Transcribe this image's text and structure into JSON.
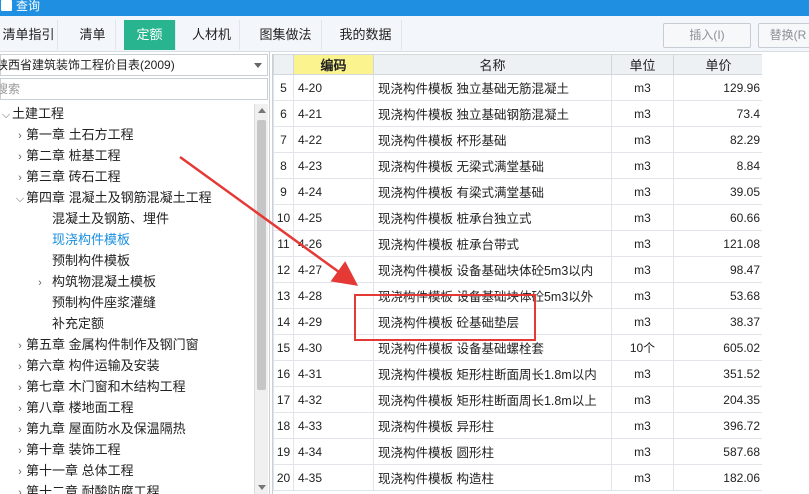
{
  "window": {
    "title": "查询"
  },
  "tabs": [
    {
      "label": "清单指引",
      "active": false
    },
    {
      "label": "清单",
      "active": false
    },
    {
      "label": "定额",
      "active": true
    },
    {
      "label": "人材机",
      "active": false
    },
    {
      "label": "图集做法",
      "active": false
    },
    {
      "label": "我的数据",
      "active": false
    }
  ],
  "buttons": {
    "insert": "插入(I)",
    "replace": "替换(R"
  },
  "library_select": {
    "value": "陕西省建筑装饰工程价目表(2009)"
  },
  "search": {
    "placeholder": "搜索"
  },
  "tree": [
    {
      "label": "土建工程",
      "caret": "down",
      "level": 0,
      "selected": false
    },
    {
      "label": "第一章  土石方工程",
      "caret": "right",
      "level": 1,
      "selected": false
    },
    {
      "label": "第二章  桩基工程",
      "caret": "right",
      "level": 1,
      "selected": false
    },
    {
      "label": "第三章  砖石工程",
      "caret": "right",
      "level": 1,
      "selected": false
    },
    {
      "label": "第四章  混凝土及钢筋混凝土工程",
      "caret": "down",
      "level": 1,
      "selected": false
    },
    {
      "label": "混凝土及钢筋、埋件",
      "caret": "",
      "level": 2,
      "selected": false
    },
    {
      "label": "现浇构件模板",
      "caret": "",
      "level": 2,
      "selected": true
    },
    {
      "label": "预制构件模板",
      "caret": "",
      "level": 2,
      "selected": false
    },
    {
      "label": "构筑物混凝土模板",
      "caret": "right",
      "level": 2,
      "selected": false
    },
    {
      "label": "预制构件座浆灌缝",
      "caret": "",
      "level": 2,
      "selected": false
    },
    {
      "label": "补充定额",
      "caret": "",
      "level": 2,
      "selected": false
    },
    {
      "label": "第五章  金属构件制作及钢门窗",
      "caret": "right",
      "level": 1,
      "selected": false
    },
    {
      "label": "第六章  构件运输及安装",
      "caret": "right",
      "level": 1,
      "selected": false
    },
    {
      "label": "第七章  木门窗和木结构工程",
      "caret": "right",
      "level": 1,
      "selected": false
    },
    {
      "label": "第八章  楼地面工程",
      "caret": "right",
      "level": 1,
      "selected": false
    },
    {
      "label": "第九章  屋面防水及保温隔热",
      "caret": "right",
      "level": 1,
      "selected": false
    },
    {
      "label": "第十章  装饰工程",
      "caret": "right",
      "level": 1,
      "selected": false
    },
    {
      "label": "第十一章  总体工程",
      "caret": "right",
      "level": 1,
      "selected": false
    },
    {
      "label": "第十二章  耐酸防腐工程",
      "caret": "right",
      "level": 1,
      "selected": false
    }
  ],
  "grid": {
    "headers": {
      "index": "",
      "code": "编码",
      "name": "名称",
      "unit": "单位",
      "price": "单价"
    },
    "rows": [
      {
        "n": "5",
        "code": "4-20",
        "name": "现浇构件模板 独立基础无筋混凝土",
        "unit": "m3",
        "price": "129.96"
      },
      {
        "n": "6",
        "code": "4-21",
        "name": "现浇构件模板 独立基础钢筋混凝土",
        "unit": "m3",
        "price": "73.4"
      },
      {
        "n": "7",
        "code": "4-22",
        "name": "现浇构件模板 杯形基础",
        "unit": "m3",
        "price": "82.29"
      },
      {
        "n": "8",
        "code": "4-23",
        "name": "现浇构件模板 无梁式满堂基础",
        "unit": "m3",
        "price": "8.84"
      },
      {
        "n": "9",
        "code": "4-24",
        "name": "现浇构件模板 有梁式满堂基础",
        "unit": "m3",
        "price": "39.05"
      },
      {
        "n": "10",
        "code": "4-25",
        "name": "现浇构件模板 桩承台独立式",
        "unit": "m3",
        "price": "60.66"
      },
      {
        "n": "11",
        "code": "4-26",
        "name": "现浇构件模板 桩承台带式",
        "unit": "m3",
        "price": "121.08"
      },
      {
        "n": "12",
        "code": "4-27",
        "name": "现浇构件模板 设备基础块体砼5m3以内",
        "unit": "m3",
        "price": "98.47"
      },
      {
        "n": "13",
        "code": "4-28",
        "name": "现浇构件模板 设备基础块体砼5m3以外",
        "unit": "m3",
        "price": "53.68"
      },
      {
        "n": "14",
        "code": "4-29",
        "name": "现浇构件模板 砼基础垫层",
        "unit": "m3",
        "price": "38.37"
      },
      {
        "n": "15",
        "code": "4-30",
        "name": "现浇构件模板 设备基础螺栓套",
        "unit": "10个",
        "price": "605.02"
      },
      {
        "n": "16",
        "code": "4-31",
        "name": "现浇构件模板 矩形柱断面周长1.8m以内",
        "unit": "m3",
        "price": "351.52"
      },
      {
        "n": "17",
        "code": "4-32",
        "name": "现浇构件模板 矩形柱断面周长1.8m以上",
        "unit": "m3",
        "price": "204.35"
      },
      {
        "n": "18",
        "code": "4-33",
        "name": "现浇构件模板 异形柱",
        "unit": "m3",
        "price": "396.72"
      },
      {
        "n": "19",
        "code": "4-34",
        "name": "现浇构件模板 圆形柱",
        "unit": "m3",
        "price": "587.68"
      },
      {
        "n": "20",
        "code": "4-35",
        "name": "现浇构件模板 构造柱",
        "unit": "m3",
        "price": "182.06"
      }
    ]
  },
  "colors": {
    "titlebar": "#1e8fe1",
    "active_tab": "#27b48e",
    "selected_tree": "#1a8fe0",
    "annotation": "#e53935",
    "code_header": "#fbf48e"
  }
}
